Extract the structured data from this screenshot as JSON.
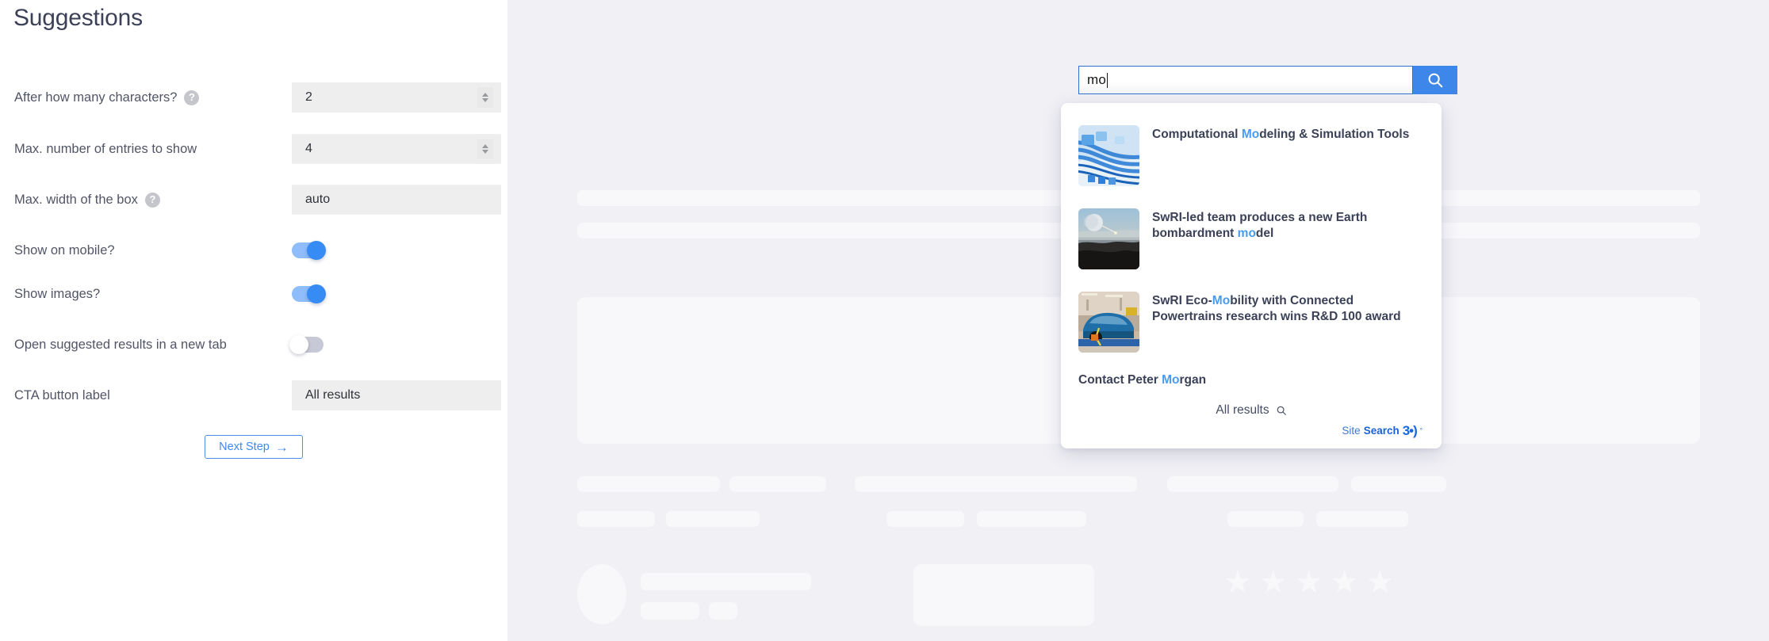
{
  "settings_panel": {
    "title": "Suggestions",
    "rows": [
      {
        "label": "After how many characters?",
        "help": "?",
        "has_help": true,
        "type": "number",
        "value": "2"
      },
      {
        "label": "Max. number of entries to show",
        "help": "?",
        "has_help": false,
        "type": "number",
        "value": "4"
      },
      {
        "label": "Max. width of the box",
        "help": "?",
        "has_help": true,
        "type": "text",
        "value": "auto"
      },
      {
        "label": "Show on mobile?",
        "help": "",
        "has_help": false,
        "type": "toggle",
        "value": "on"
      },
      {
        "label": "Show images?",
        "help": "",
        "has_help": false,
        "type": "toggle",
        "value": "on"
      },
      {
        "label": "Open suggested results in a new tab",
        "help": "",
        "has_help": false,
        "type": "toggle",
        "value": "off"
      },
      {
        "label": "CTA button label",
        "help": "",
        "has_help": false,
        "type": "text",
        "value": "All results"
      }
    ],
    "next_button": {
      "label": "Next Step",
      "arrow": "→"
    }
  },
  "preview": {
    "search": {
      "query": "mo",
      "placeholder": "",
      "button_icon": "search-icon"
    },
    "dropdown": {
      "results": [
        {
          "title_pre": "Computational ",
          "title_hl": "Mo",
          "title_post": "deling & Simulation Tools",
          "thumb": "network-cables-image"
        },
        {
          "title_pre": "SwRI-led team produces a new Earth bombardment ",
          "title_hl": "mo",
          "title_post": "del",
          "thumb": "earth-moon-landscape-image"
        },
        {
          "title_pre": "SwRI Eco-",
          "title_hl": "Mo",
          "title_post": "bility with Connected Powertrains research wins R&D 100 award",
          "thumb": "blue-car-dyno-image"
        }
      ],
      "contact": {
        "pre": "Contact Peter ",
        "hl": "Mo",
        "post": "rgan"
      },
      "cta": {
        "label": "All results",
        "icon": "search-icon"
      },
      "brand": {
        "part1": "Site ",
        "part2": "Search",
        "part3": "3•)",
        "degree": "°"
      }
    }
  },
  "colors": {
    "accent_blue": "#368bf5",
    "highlight_blue": "#4a9bf0",
    "panel_bg": "#ffffff",
    "preview_bg": "#f0f0f5",
    "skeleton": "#f8f8fb",
    "field_bg": "#eeeeee",
    "text_dark": "#3b4157"
  }
}
